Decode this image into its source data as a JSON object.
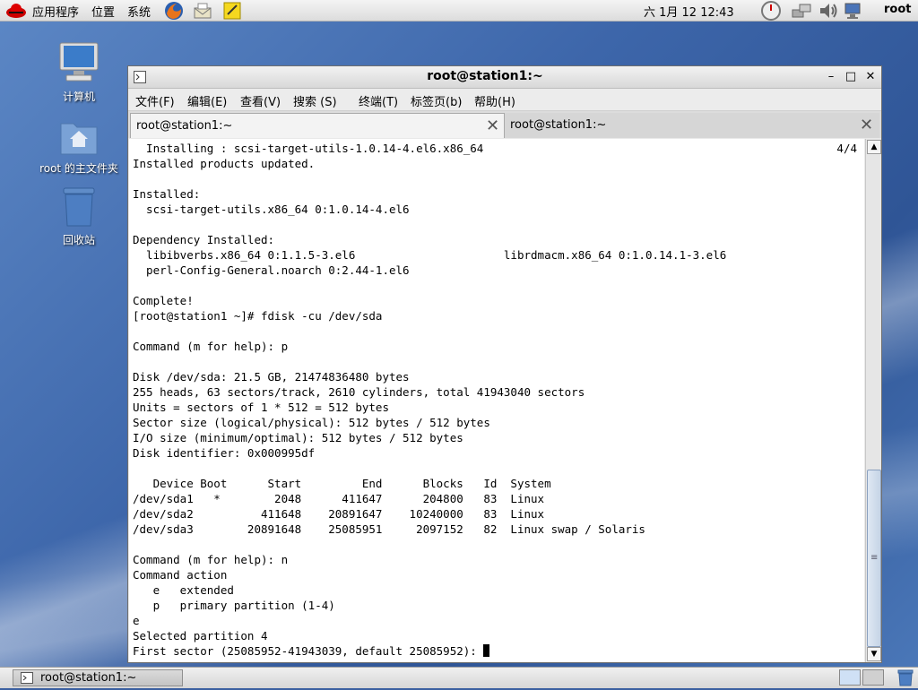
{
  "top_panel": {
    "menu": [
      "应用程序",
      "位置",
      "系统"
    ],
    "clock": "六 1月 12 12:43",
    "user": "root"
  },
  "desktop": {
    "icons": [
      {
        "label": "计算机",
        "icon": "computer-icon"
      },
      {
        "label": "root 的主文件夹",
        "icon": "home-folder-icon"
      },
      {
        "label": "回收站",
        "icon": "trash-icon"
      }
    ]
  },
  "window": {
    "title": "root@station1:~",
    "menubar": [
      "文件(F)",
      "编辑(E)",
      "查看(V)",
      "搜索 (S)",
      "终端(T)",
      "标签页(b)",
      "帮助(H)"
    ],
    "tabs": [
      {
        "label": "root@station1:~",
        "active": true
      },
      {
        "label": "root@station1:~",
        "active": false
      }
    ],
    "terminal": {
      "progress": "4/4",
      "lines": [
        "  Installing : scsi-target-utils-1.0.14-4.el6.x86_64",
        "Installed products updated.",
        "",
        "Installed:",
        "  scsi-target-utils.x86_64 0:1.0.14-4.el6",
        "",
        "Dependency Installed:",
        "  libibverbs.x86_64 0:1.1.5-3.el6                      librdmacm.x86_64 0:1.0.14.1-3.el6",
        "  perl-Config-General.noarch 0:2.44-1.el6",
        "",
        "Complete!",
        "[root@station1 ~]# fdisk -cu /dev/sda",
        "",
        "Command (m for help): p",
        "",
        "Disk /dev/sda: 21.5 GB, 21474836480 bytes",
        "255 heads, 63 sectors/track, 2610 cylinders, total 41943040 sectors",
        "Units = sectors of 1 * 512 = 512 bytes",
        "Sector size (logical/physical): 512 bytes / 512 bytes",
        "I/O size (minimum/optimal): 512 bytes / 512 bytes",
        "Disk identifier: 0x000995df",
        "",
        "   Device Boot      Start         End      Blocks   Id  System",
        "/dev/sda1   *        2048      411647      204800   83  Linux",
        "/dev/sda2          411648    20891647    10240000   83  Linux",
        "/dev/sda3        20891648    25085951     2097152   82  Linux swap / Solaris",
        "",
        "Command (m for help): n",
        "Command action",
        "   e   extended",
        "   p   primary partition (1-4)",
        "e",
        "Selected partition 4",
        "First sector (25085952-41943039, default 25085952): "
      ]
    }
  },
  "taskbar": {
    "task_label": "root@station1:~"
  }
}
